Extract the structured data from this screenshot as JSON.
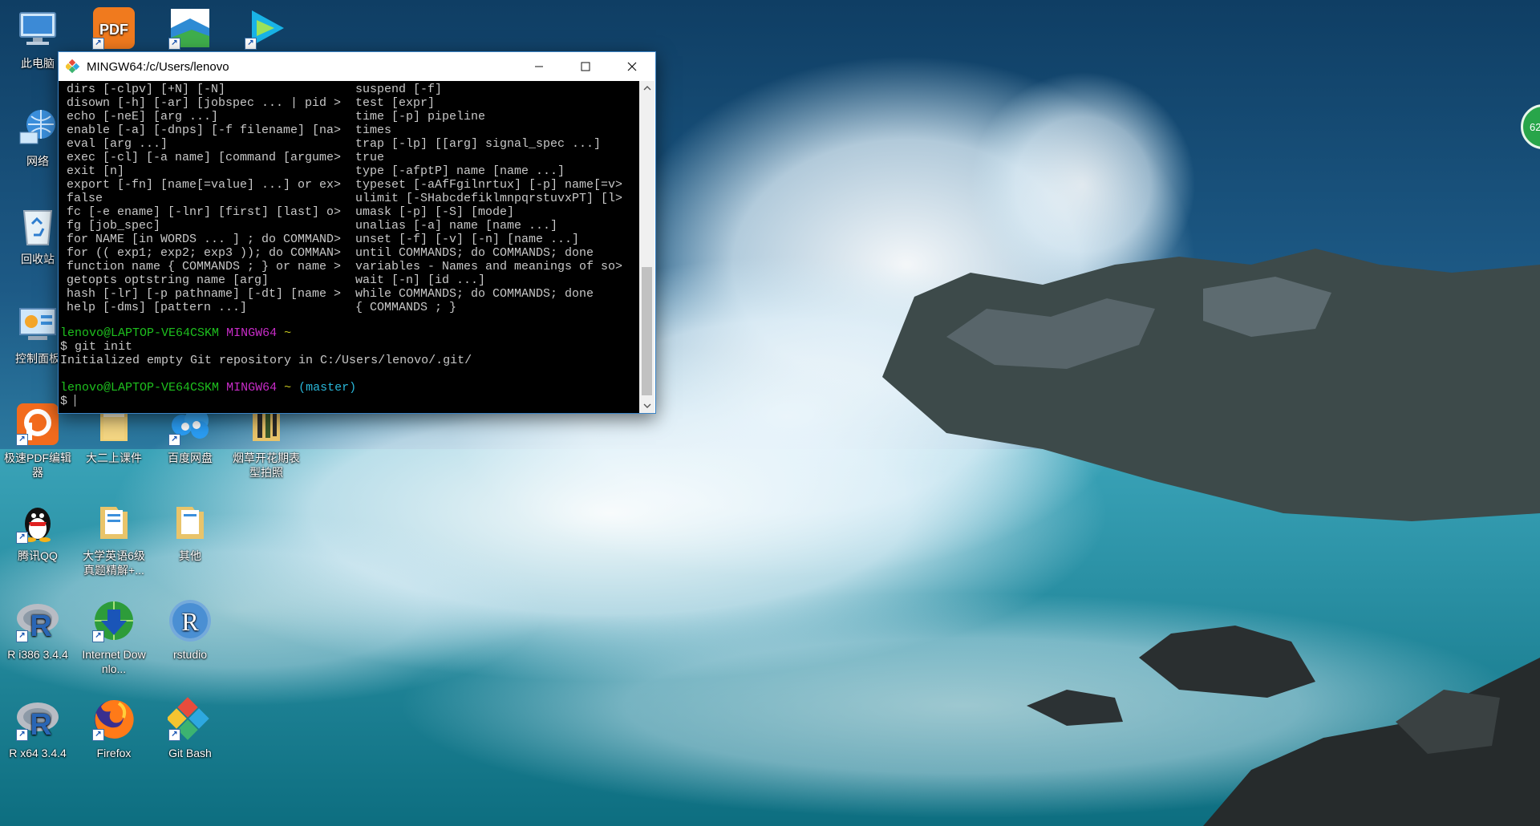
{
  "desktop": {
    "icons": [
      {
        "label": "此电脑",
        "icon": "computer-icon"
      },
      {
        "label": "",
        "icon": "pdf-editor-shortcut-icon"
      },
      {
        "label": "",
        "icon": "app-shortcut-icon"
      },
      {
        "label": "",
        "icon": "video-player-shortcut-icon"
      },
      {
        "label": "网络",
        "icon": "network-icon"
      },
      {
        "label": "回收站",
        "icon": "recycle-bin-icon"
      },
      {
        "label": "控制面板",
        "icon": "control-panel-icon"
      },
      {
        "label": "极速PDF编辑器",
        "icon": "pdf-editor-icon"
      },
      {
        "label": "大二上课件",
        "icon": "folder-icon"
      },
      {
        "label": "百度网盘",
        "icon": "baidu-netdisk-icon"
      },
      {
        "label": "烟草开花期表型拍照",
        "icon": "folder-icon"
      },
      {
        "label": "腾讯QQ",
        "icon": "qq-icon"
      },
      {
        "label": "大学英语6级真题精解+...",
        "icon": "folder-icon"
      },
      {
        "label": "其他",
        "icon": "folder-icon"
      },
      {
        "label": "R i386 3.4.4",
        "icon": "r-icon"
      },
      {
        "label": "Internet Downlo...",
        "icon": "internet-download-manager-icon"
      },
      {
        "label": "rstudio",
        "icon": "rstudio-icon"
      },
      {
        "label": "R x64 3.4.4",
        "icon": "r-icon"
      },
      {
        "label": "Firefox",
        "icon": "firefox-icon"
      },
      {
        "label": "Git Bash",
        "icon": "git-bash-icon"
      }
    ],
    "floating_badge": "62"
  },
  "window": {
    "title": "MINGW64:/c/Users/lenovo",
    "minimize_symbol": "—",
    "maximize_symbol": "☐",
    "close_symbol": "✕"
  },
  "terminal": {
    "help_left": [
      "dirs [-clpv] [+N] [-N]",
      "disown [-h] [-ar] [jobspec ... | pid >",
      "echo [-neE] [arg ...]",
      "enable [-a] [-dnps] [-f filename] [na>",
      "eval [arg ...]",
      "exec [-cl] [-a name] [command [argume>",
      "exit [n]",
      "export [-fn] [name[=value] ...] or ex>",
      "false",
      "fc [-e ename] [-lnr] [first] [last] o>",
      "fg [job_spec]",
      "for NAME [in WORDS ... ] ; do COMMAND>",
      "for (( exp1; exp2; exp3 )); do COMMAN>",
      "function name { COMMANDS ; } or name >",
      "getopts optstring name [arg]",
      "hash [-lr] [-p pathname] [-dt] [name >",
      "help [-dms] [pattern ...]"
    ],
    "help_right": [
      "suspend [-f]",
      "test [expr]",
      "time [-p] pipeline",
      "times",
      "trap [-lp] [[arg] signal_spec ...]",
      "true",
      "type [-afptP] name [name ...]",
      "typeset [-aAfFgilnrtux] [-p] name[=v>",
      "ulimit [-SHabcdefiklmnpqrstuvxPT] [l>",
      "umask [-p] [-S] [mode]",
      "unalias [-a] name [name ...]",
      "unset [-f] [-v] [-n] [name ...]",
      "until COMMANDS; do COMMANDS; done",
      "variables - Names and meanings of so>",
      "wait [-n] [id ...]",
      "while COMMANDS; do COMMANDS; done",
      "{ COMMANDS ; }"
    ],
    "prompt1_user": "lenovo@LAPTOP-VE64CSKM",
    "prompt1_sys": "MINGW64",
    "prompt1_dir": "~",
    "command1": "$ git init",
    "output1": "Initialized empty Git repository in C:/Users/lenovo/.git/",
    "prompt2_user": "lenovo@LAPTOP-VE64CSKM",
    "prompt2_sys": "MINGW64",
    "prompt2_dir": "~",
    "prompt2_branch": "(master)",
    "command2": "$ "
  },
  "colors": {
    "prompt_user": "#1ec01e",
    "prompt_sys": "#c82cc8",
    "prompt_dir": "#c8c81e",
    "prompt_branch": "#29b6d8"
  }
}
